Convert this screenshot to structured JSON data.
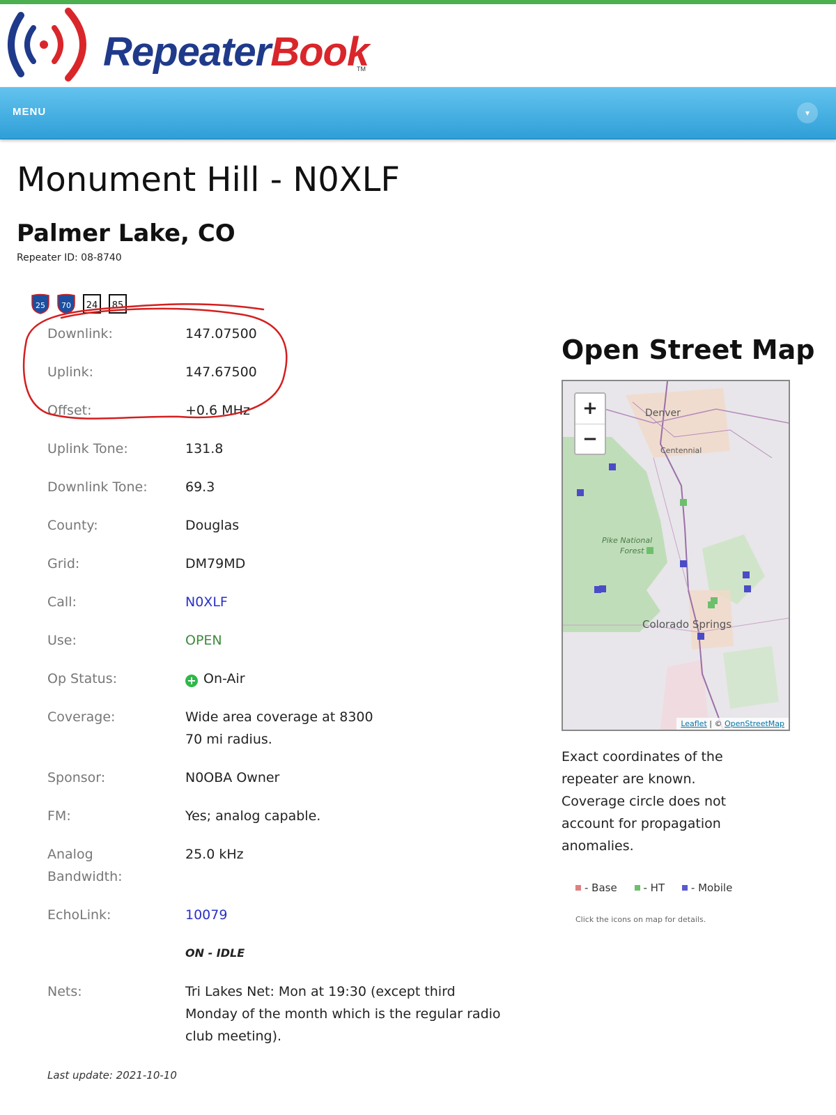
{
  "logo": {
    "text_a": "Repeater",
    "text_b": "Book",
    "tm": "TM"
  },
  "menu": {
    "label": "MENU",
    "toggle_icon": "chevron-down"
  },
  "header": {
    "title": "Monument Hill - N0XLF",
    "location": "Palmer Lake, CO",
    "repeater_id": "Repeater ID: 08-8740"
  },
  "shields": [
    {
      "kind": "interstate",
      "number": "25"
    },
    {
      "kind": "interstate",
      "number": "70"
    },
    {
      "kind": "us-route",
      "number": "24"
    },
    {
      "kind": "us-route",
      "number": "85"
    }
  ],
  "details": {
    "downlink": {
      "label": "Downlink:",
      "value": "147.07500"
    },
    "uplink": {
      "label": "Uplink:",
      "value": "147.67500"
    },
    "offset": {
      "label": "Offset:",
      "value": "+0.6 MHz"
    },
    "uplink_tone": {
      "label": "Uplink Tone:",
      "value": "131.8"
    },
    "downlink_tone": {
      "label": "Downlink Tone:",
      "value": "69.3"
    },
    "county": {
      "label": "County:",
      "value": "Douglas"
    },
    "grid": {
      "label": "Grid:",
      "value": "DM79MD"
    },
    "call": {
      "label": "Call:",
      "value": "N0XLF"
    },
    "use": {
      "label": "Use:",
      "value": "OPEN"
    },
    "op_status": {
      "label": "Op Status:",
      "value": "On-Air"
    },
    "coverage": {
      "label": "Coverage:",
      "value_line1": "Wide area coverage at 8300",
      "value_line2": "70 mi radius."
    },
    "sponsor": {
      "label": "Sponsor:",
      "value": "N0OBA Owner"
    },
    "fm": {
      "label": "FM:",
      "value": "Yes; analog capable."
    },
    "analog_bw": {
      "label_line1": "Analog",
      "label_line2": "Bandwidth:",
      "value": "25.0 kHz"
    },
    "echolink": {
      "label": "EchoLink:",
      "value": "10079",
      "status": "ON - IDLE"
    },
    "nets": {
      "label": "Nets:",
      "value_line1": "Tri Lakes Net: Mon at 19:30 (except third",
      "value_line2": "Monday of the month which is the regular radio",
      "value_line3": "club meeting)."
    },
    "last_update": "Last update: 2021-10-10"
  },
  "map": {
    "title": "Open Street Map",
    "zoom_in": "+",
    "zoom_out": "−",
    "place_labels": [
      "Denver",
      "Centennial",
      "Pike National",
      "Forest",
      "Colorado Springs"
    ],
    "attribution_a": "Leaflet",
    "attribution_sep": " | © ",
    "attribution_b": "OpenStreetMap",
    "note_line1": "Exact coordinates of the",
    "note_line2": "repeater are known.",
    "note_line3": "Coverage circle does not",
    "note_line4": "account for propagation",
    "note_line5": "anomalies.",
    "legend": [
      {
        "label": "- Base",
        "color": "#e08080"
      },
      {
        "label": "- HT",
        "color": "#6cc06c"
      },
      {
        "label": "- Mobile",
        "color": "#5a5ad0"
      }
    ],
    "hint": "Click the icons on map for details."
  },
  "colors": {
    "menu": "#3ea9dd",
    "link": "#2a31c8",
    "open": "#3d8a3d",
    "annotation": "#d41f1f"
  }
}
